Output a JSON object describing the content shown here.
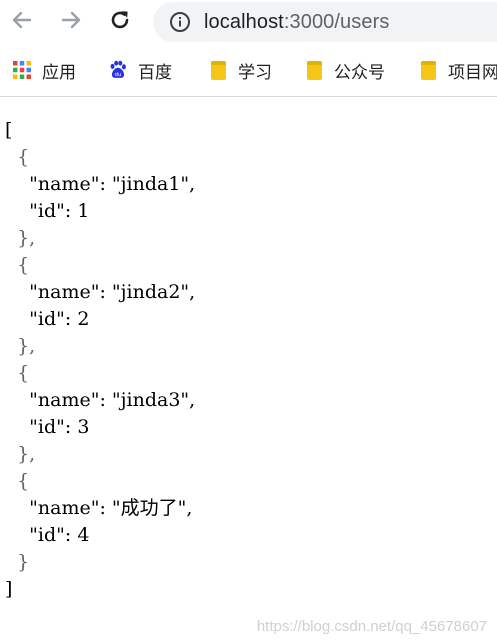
{
  "browser": {
    "back_icon": "arrow-left-icon",
    "forward_icon": "arrow-right-icon",
    "reload_icon": "reload-icon",
    "site_info_icon": "info-circle-icon",
    "url_host": "localhost",
    "url_path": ":3000/users"
  },
  "bookmarks": [
    {
      "label": "应用",
      "icon": "apps-grid-icon"
    },
    {
      "label": "百度",
      "icon": "baidu-paw-icon"
    },
    {
      "label": "学习",
      "icon": "folder-icon"
    },
    {
      "label": "公众号",
      "icon": "folder-icon"
    },
    {
      "label": "项目网",
      "icon": "folder-icon"
    }
  ],
  "json_lines": [
    "[",
    "  {",
    "    \"name\": \"jinda1\",",
    "    \"id\": 1",
    "  },",
    "  {",
    "    \"name\": \"jinda2\",",
    "    \"id\": 2",
    "  },",
    "  {",
    "    \"name\": \"jinda3\",",
    "    \"id\": 3",
    "  },",
    "  {",
    "    \"name\": \"成功了\",",
    "    \"id\": 4",
    "  }",
    "]"
  ],
  "watermark": "https://blog.csdn.net/qq_45678607",
  "colors": {
    "omnibox_bg": "#f1f3f4",
    "folder": "#f5c518",
    "baidu_blue": "#2932e1"
  }
}
